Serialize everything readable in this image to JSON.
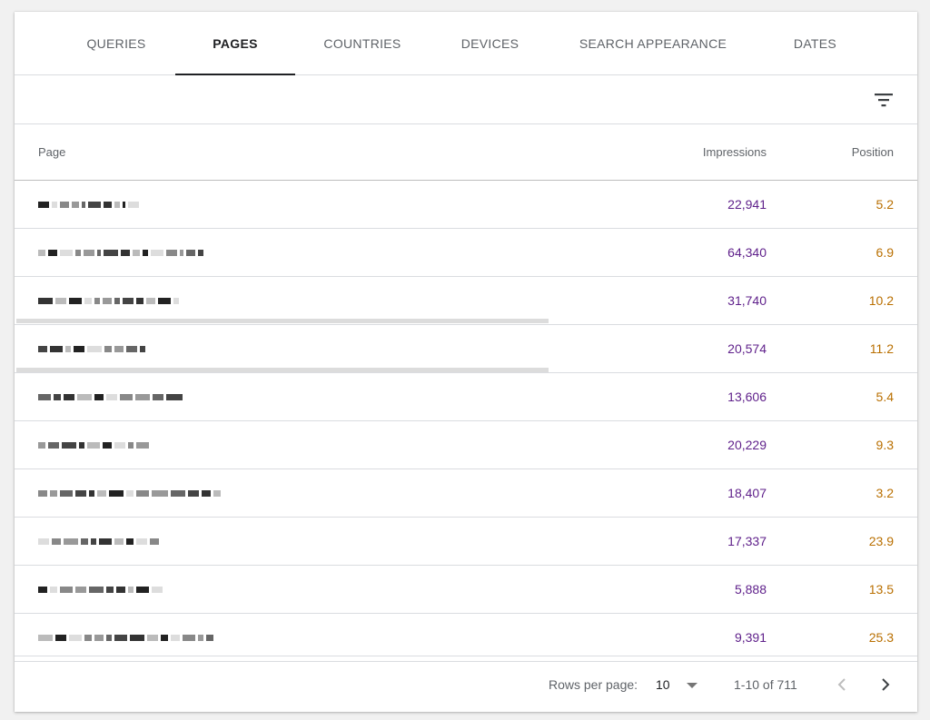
{
  "tabs": [
    {
      "label": "QUERIES",
      "active": false
    },
    {
      "label": "PAGES",
      "active": true
    },
    {
      "label": "COUNTRIES",
      "active": false
    },
    {
      "label": "DEVICES",
      "active": false
    },
    {
      "label": "SEARCH APPEARANCE",
      "active": false
    },
    {
      "label": "DATES",
      "active": false
    }
  ],
  "toolbar": {
    "filter_icon": "filter-list-icon"
  },
  "table": {
    "headers": {
      "page": "Page",
      "impressions": "Impressions",
      "position": "Position"
    },
    "rows": [
      {
        "page": "",
        "impressions": "22,941",
        "position": "5.2"
      },
      {
        "page": "",
        "impressions": "64,340",
        "position": "6.9"
      },
      {
        "page": "",
        "impressions": "31,740",
        "position": "10.2"
      },
      {
        "page": "",
        "impressions": "20,574",
        "position": "11.2"
      },
      {
        "page": "",
        "impressions": "13,606",
        "position": "5.4"
      },
      {
        "page": "",
        "impressions": "20,229",
        "position": "9.3"
      },
      {
        "page": "",
        "impressions": "18,407",
        "position": "3.2"
      },
      {
        "page": "",
        "impressions": "17,337",
        "position": "23.9"
      },
      {
        "page": "",
        "impressions": "5,888",
        "position": "13.5"
      },
      {
        "page": "",
        "impressions": "9,391",
        "position": "25.3"
      }
    ]
  },
  "pagination": {
    "rows_per_page_label": "Rows per page:",
    "rows_per_page_value": "10",
    "range": "1-10 of 711",
    "prev_icon": "chevron-left-icon",
    "next_icon": "chevron-right-icon"
  },
  "colors": {
    "impressions": "#5e1f8a",
    "position": "#b96f00",
    "active_tab_indicator": "#202124"
  }
}
